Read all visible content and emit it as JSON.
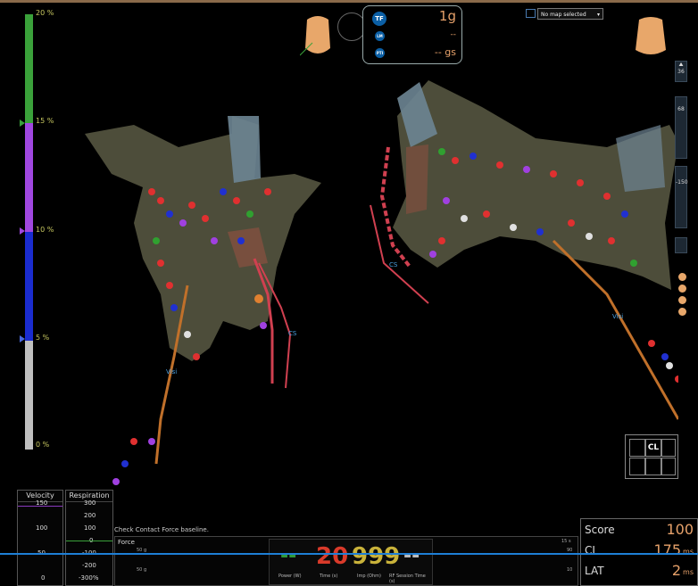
{
  "scale": {
    "labels": [
      "20 %",
      "15 %",
      "10 %",
      "5 %",
      "0 %"
    ],
    "colors": {
      "top": "#3aa13a",
      "mid_upper": "#a047e0",
      "mid_lower": "#1a2ccf",
      "bottom": "#bfbfbf"
    }
  },
  "hud": {
    "buttons": [
      "TF",
      "LM",
      "PTI"
    ],
    "values": [
      "1g",
      "--",
      "-- gs"
    ]
  },
  "map_selector": {
    "value": "No map selected"
  },
  "toolbar": {
    "zoom_value": "36",
    "opacity_value": "68",
    "threshold_value": "-150"
  },
  "maps": {
    "left_catheter_labels": [
      "Visi",
      "CS"
    ],
    "right_catheter_labels": [
      "CS",
      "Visi"
    ]
  },
  "velocity": {
    "title": "Velocity",
    "ticks": [
      "150",
      "100",
      "50",
      "0"
    ]
  },
  "respiration": {
    "title": "Respiration",
    "ticks": [
      "300",
      "200",
      "100",
      "0",
      "-100",
      "-200",
      "-300%"
    ]
  },
  "status_message": "Check Contact Force baseline.",
  "force": {
    "title": "Force",
    "left_ticks": [
      "50 g",
      "50 g"
    ],
    "right_ticks": [
      "15 s",
      "90",
      "10"
    ],
    "power": {
      "value": "--",
      "label": "Power (W)"
    },
    "time": {
      "value": "20",
      "label": "Time (s)"
    },
    "imp": {
      "value": "999",
      "label": "Imp (Ohm)"
    },
    "rf": {
      "value": "--",
      "label": "RF Session Time (s)"
    }
  },
  "score_panel": {
    "score_label": "Score",
    "score_value": "100",
    "cl_label": "CL",
    "cl_value": "175",
    "cl_unit": "ms",
    "lat_label": "LAT",
    "lat_value": "2",
    "lat_unit": "ms"
  },
  "display_mode_panel": {
    "cl_button": "CL"
  },
  "colors": {
    "accent": "#e6a16a",
    "hud_button": "#0b5fa5",
    "axis_line": "#1e7fd6",
    "time_red": "#d93a2a",
    "imp_yellow": "#c9b23a",
    "power_green": "#2f9a3a"
  }
}
